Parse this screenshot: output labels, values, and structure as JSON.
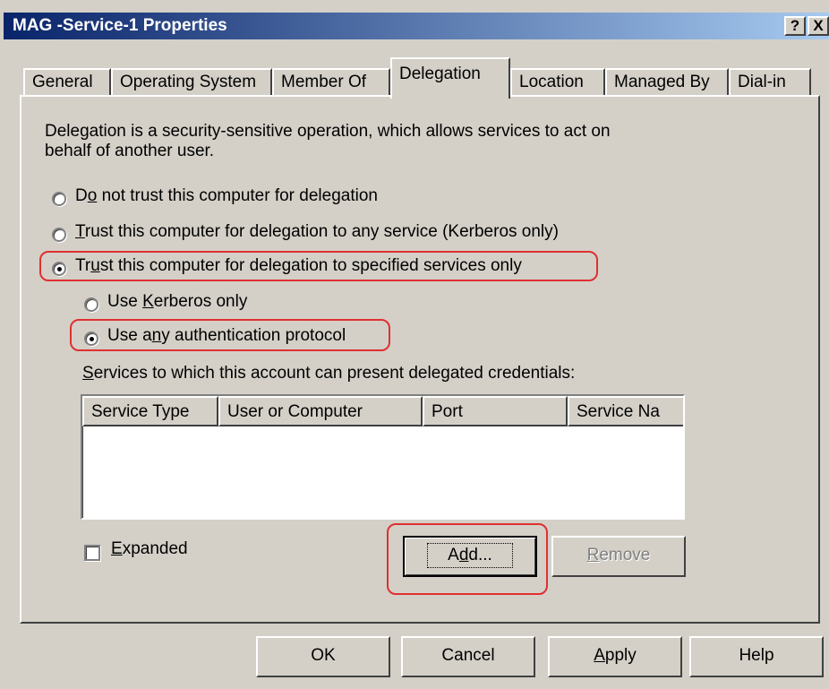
{
  "window": {
    "title": "MAG -Service-1 Properties",
    "help_button": "?",
    "close_button": "X"
  },
  "tabs": [
    {
      "label": "General"
    },
    {
      "label": "Operating System"
    },
    {
      "label": "Member Of"
    },
    {
      "label": "Delegation",
      "selected": true
    },
    {
      "label": "Location"
    },
    {
      "label": "Managed By"
    },
    {
      "label": "Dial-in"
    }
  ],
  "delegation": {
    "description_line1": "Delegation is a security-sensitive operation, which allows services to act on",
    "description_line2": "behalf of another user.",
    "options": {
      "do_not_trust": {
        "pre": "D",
        "mnemonic": "o",
        "post": " not trust this computer for delegation",
        "checked": false
      },
      "trust_any": {
        "pre": "",
        "mnemonic": "T",
        "post": "rust this computer for delegation to any service (Kerberos only)",
        "checked": false
      },
      "trust_specified": {
        "pre": "Tr",
        "mnemonic": "u",
        "post": "st this computer for delegation to specified services only",
        "checked": true
      }
    },
    "protocol": {
      "kerberos_only": {
        "pre": "Use ",
        "mnemonic": "K",
        "post": "erberos only",
        "checked": false
      },
      "any_protocol": {
        "pre": "Use a",
        "mnemonic": "n",
        "post": "y authentication protocol",
        "checked": true
      }
    },
    "services_label_mnemonic": "S",
    "services_label_rest": "ervices to which this account can present delegated credentials:",
    "columns": [
      "Service Type",
      "User or Computer",
      "Port",
      "Service Na"
    ],
    "rows": [],
    "expanded": {
      "mnemonic": "E",
      "rest": "xpanded",
      "checked": false
    },
    "add_button": {
      "pre": "A",
      "mnemonic": "d",
      "post": "d..."
    },
    "remove_button": {
      "mnemonic": "R",
      "rest": "emove",
      "enabled": false
    }
  },
  "footer": {
    "ok": "OK",
    "cancel": "Cancel",
    "apply_mnemonic": "A",
    "apply_rest": "pply",
    "help": "Help"
  },
  "colors": {
    "title_gradient_start": "#0a246a",
    "title_gradient_end": "#a6caf0",
    "highlight": "#e03030",
    "face": "#d4d0c8"
  }
}
